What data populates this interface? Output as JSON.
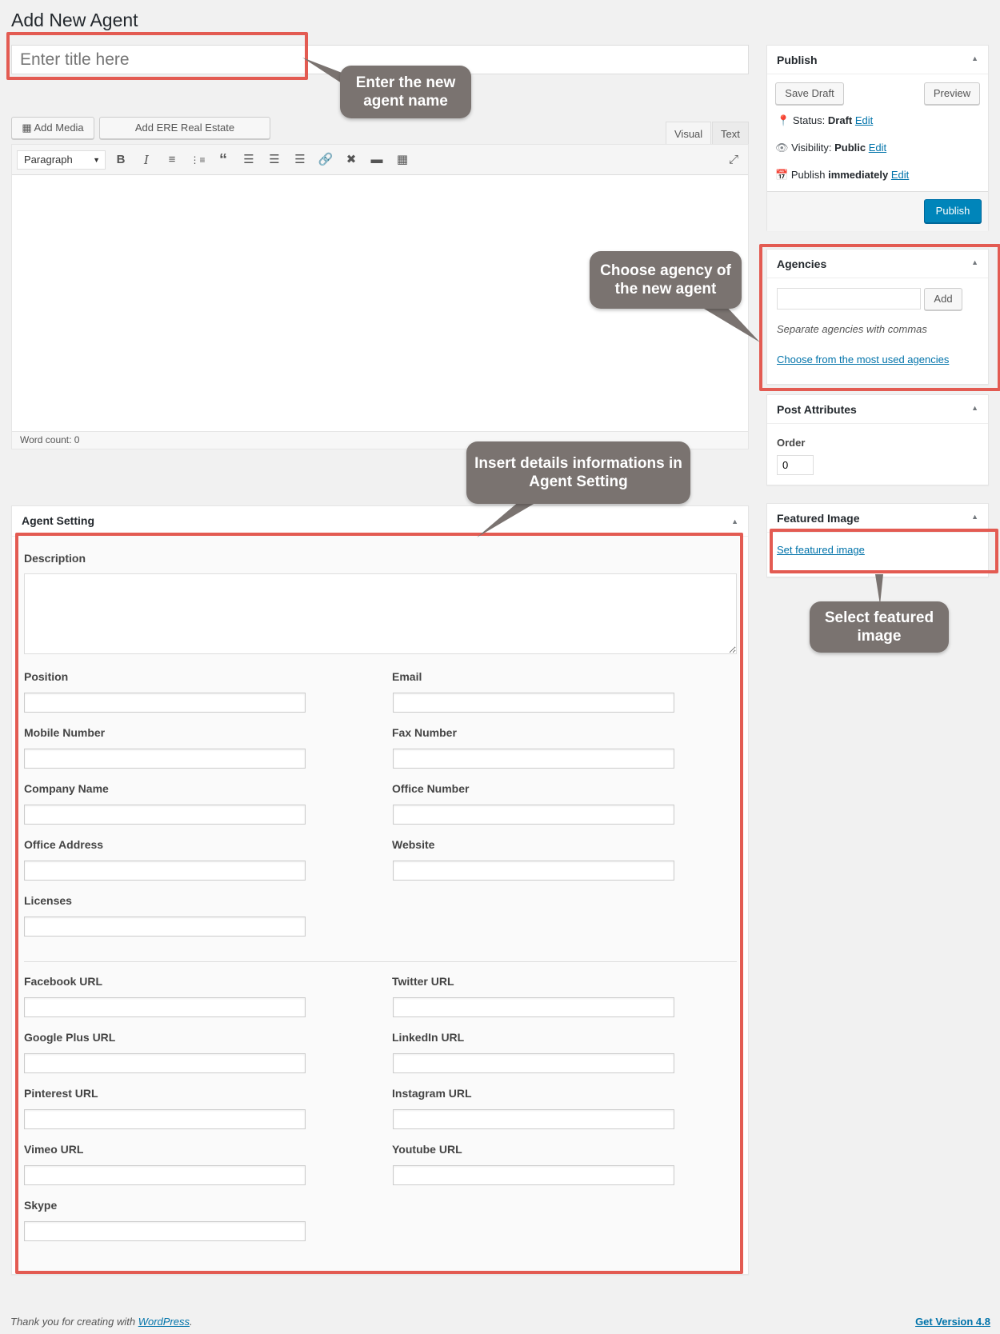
{
  "page": {
    "title": "Add New Agent",
    "title_placeholder": "Enter title here"
  },
  "editor": {
    "add_media": "Add Media",
    "shortcodes": "Add ERE Real Estate Shortcodes",
    "tab_visual": "Visual",
    "tab_text": "Text",
    "format": "Paragraph",
    "word_count": "Word count: 0"
  },
  "publish": {
    "title": "Publish",
    "save_draft": "Save Draft",
    "preview": "Preview",
    "status_label": "Status:",
    "status_value": "Draft",
    "visibility_label": "Visibility:",
    "visibility_value": "Public",
    "publish_label": "Publish",
    "publish_value": "immediately",
    "edit": "Edit",
    "publish_button": "Publish"
  },
  "agencies": {
    "title": "Agencies",
    "add": "Add",
    "hint": "Separate agencies with commas",
    "most_used": "Choose from the most used agencies"
  },
  "post_attributes": {
    "title": "Post Attributes",
    "order_label": "Order",
    "order_value": "0"
  },
  "featured_image": {
    "title": "Featured Image",
    "link": "Set featured image"
  },
  "agent_setting": {
    "title": "Agent Setting",
    "description": "Description",
    "fields": {
      "position": "Position",
      "email": "Email",
      "mobile": "Mobile Number",
      "fax": "Fax Number",
      "company": "Company Name",
      "office_number": "Office Number",
      "office_address": "Office Address",
      "website": "Website",
      "licenses": "Licenses",
      "facebook": "Facebook URL",
      "twitter": "Twitter URL",
      "googleplus": "Google Plus URL",
      "linkedin": "LinkedIn URL",
      "pinterest": "Pinterest URL",
      "instagram": "Instagram URL",
      "vimeo": "Vimeo URL",
      "youtube": "Youtube URL",
      "skype": "Skype"
    }
  },
  "callouts": {
    "title": "Enter the new agent name",
    "agency": "Choose agency of the new agent",
    "details": "Insert details informations in Agent Setting",
    "featured": "Select featured image"
  },
  "footer": {
    "thanks": "Thank you for creating with",
    "wp": "WordPress",
    "version": "Get Version 4.8"
  },
  "colors": {
    "annotation_red": "#e35b52",
    "callout_bg": "#7a7370",
    "link": "#0073aa",
    "primary": "#0085ba"
  }
}
